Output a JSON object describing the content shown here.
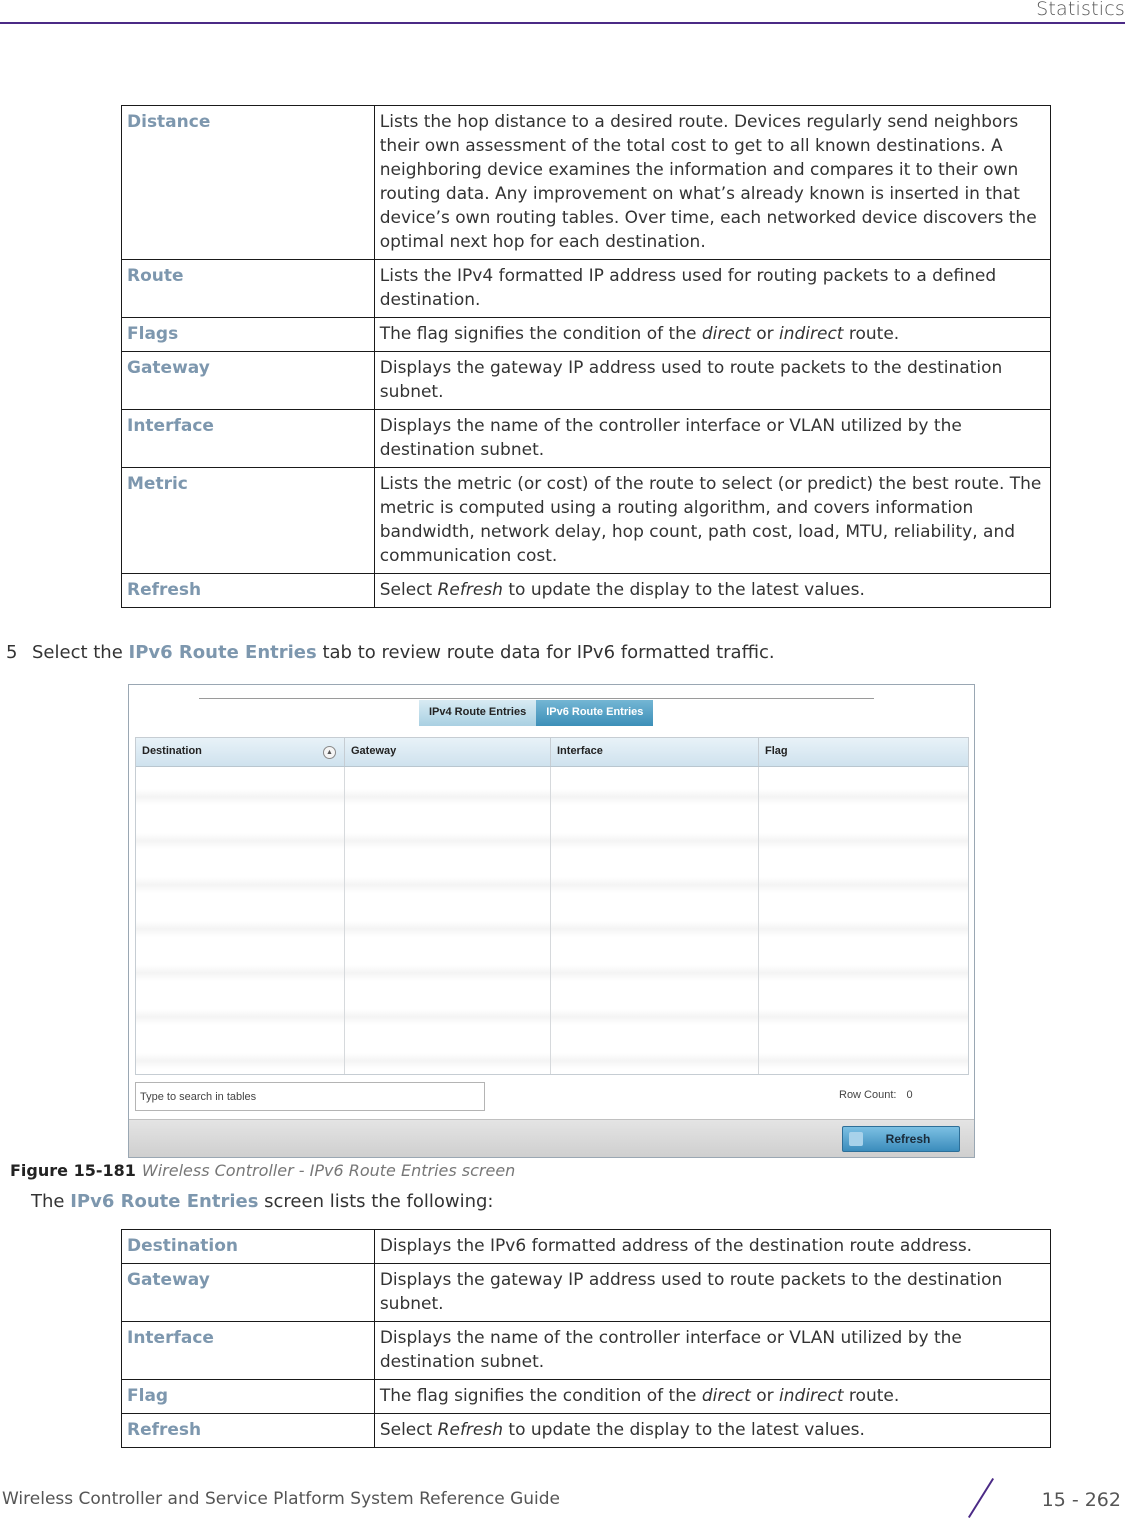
{
  "header": {
    "title": "Statistics"
  },
  "table1": {
    "rows": [
      {
        "term": "Distance",
        "def": "Lists the hop distance to a desired route. Devices regularly send neighbors their own assessment of the total cost to get to all known destinations. A neighboring device examines the information and compares it to their own routing data. Any improvement on what’s already known is inserted in that device’s own routing tables. Over time, each networked device discovers the optimal next hop for each destination."
      },
      {
        "term": "Route",
        "def": "Lists the IPv4 formatted IP address used for routing packets to a defined destination."
      },
      {
        "term": "Flags",
        "def_pre": "The flag signifies the condition of the ",
        "def_it1": "direct",
        "def_mid": " or ",
        "def_it2": "indirect",
        "def_post": " route."
      },
      {
        "term": "Gateway",
        "def": "Displays the gateway IP address used to route packets to the destination subnet."
      },
      {
        "term": "Interface",
        "def": "Displays the name of the controller interface or VLAN utilized by the destination subnet."
      },
      {
        "term": "Metric",
        "def": "Lists the metric (or cost) of the route to select (or predict) the best route. The metric is computed using a routing algorithm, and covers information bandwidth, network delay, hop count, path cost, load, MTU, reliability, and communication cost."
      },
      {
        "term": "Refresh",
        "def_pre": "Select ",
        "def_it": "Refresh",
        "def_post": " to update the display to the latest values."
      }
    ]
  },
  "step": {
    "number": "5",
    "pre": "Select the ",
    "highlight": "IPv6 Route Entries",
    "post": " tab to review route data for IPv6 formatted traffic."
  },
  "screen": {
    "tabs": [
      {
        "label": "IPv4 Route Entries",
        "active": false
      },
      {
        "label": "IPv6 Route Entries",
        "active": true
      }
    ],
    "columns": [
      "Destination",
      "Gateway",
      "Interface",
      "Flag"
    ],
    "search_placeholder": "Type to search in tables",
    "row_count_label": "Row Count:",
    "row_count_value": "0",
    "refresh_label": "Refresh",
    "active_tab_color": "#3c8fb8"
  },
  "caption": {
    "figure": "Figure 15-181",
    "text": "Wireless Controller - IPv6 Route Entries screen"
  },
  "intro": {
    "pre": "The ",
    "highlight": "IPv6 Route Entries",
    "post": " screen lists the following:"
  },
  "table2": {
    "rows": [
      {
        "term": "Destination",
        "def": "Displays the IPv6 formatted address of the destination route address."
      },
      {
        "term": "Gateway",
        "def": "Displays the gateway IP address used to route packets to the destination subnet."
      },
      {
        "term": "Interface",
        "def": "Displays the name of the controller interface or VLAN utilized by the destination subnet."
      },
      {
        "term": "Flag",
        "def_pre": "The flag signifies the condition of the ",
        "def_it1": "direct",
        "def_mid": " or ",
        "def_it2": "indirect",
        "def_post": " route."
      },
      {
        "term": "Refresh",
        "def_pre": "Select ",
        "def_it": "Refresh",
        "def_post": " to update the display to the latest values."
      }
    ]
  },
  "footer": {
    "guide_title": "Wireless Controller and Service Platform System Reference Guide",
    "page_number": "15 - 262"
  },
  "colors": {
    "accent_purple": "#4b2a86",
    "term_blue": "#7d97ae"
  }
}
